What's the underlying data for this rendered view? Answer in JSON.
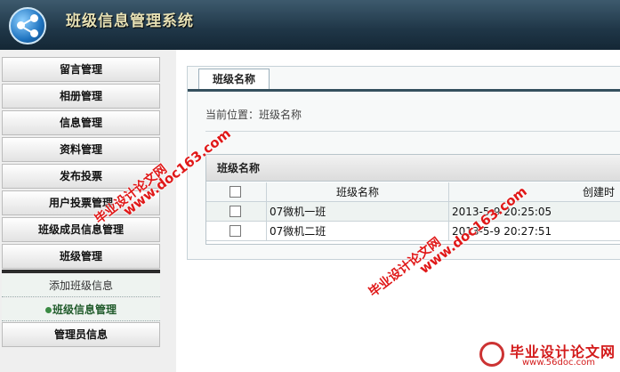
{
  "app": {
    "title": "班级信息管理系统"
  },
  "sidebar": {
    "items": [
      {
        "label": "留言管理"
      },
      {
        "label": "相册管理"
      },
      {
        "label": "信息管理"
      },
      {
        "label": "资料管理"
      },
      {
        "label": "发布投票"
      },
      {
        "label": "用户投票管理"
      },
      {
        "label": "班级成员信息管理"
      },
      {
        "label": "班级管理"
      }
    ],
    "sub_items": [
      {
        "label": "添加班级信息",
        "active": false
      },
      {
        "label": "班级信息管理",
        "active": true
      }
    ],
    "bottom_item": {
      "label": "管理员信息"
    }
  },
  "main": {
    "tab": {
      "label": "班级名称"
    },
    "breadcrumb": "当前位置：班级名称",
    "grid": {
      "title": "班级名称",
      "columns": [
        "",
        "班级名称",
        "创建时"
      ],
      "rows": [
        {
          "name": "07微机一班",
          "created": "2013-5-9 20:25:05"
        },
        {
          "name": "07微机二班",
          "created": "2013-5-9 20:27:51"
        }
      ]
    }
  },
  "watermarks": {
    "site_name": "毕业设计论文网",
    "site_url": "www.doc163.com",
    "corner_title": "毕业设计论文网",
    "corner_url": "www.56doc.com"
  },
  "colors": {
    "header_dark": "#142735",
    "title_text": "#e7e1b5",
    "watermark_red": "#e01818",
    "tab_line": "#35505e"
  }
}
